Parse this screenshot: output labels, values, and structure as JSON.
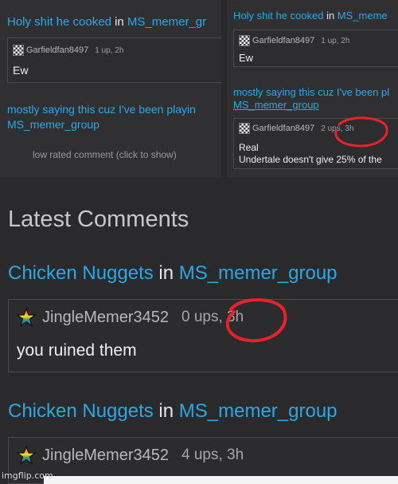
{
  "top_left": {
    "thread1": {
      "title": "Holy shit he cooked",
      "in": " in ",
      "group": "MS_memer_gr"
    },
    "comment1": {
      "user": "Garfieldfan8497",
      "meta": "1 up, 2h",
      "body": "Ew"
    },
    "thread2": {
      "title": "mostly saying this cuz I've been playin",
      "group": "MS_memer_group"
    },
    "low_rated": "low rated comment (click to show)"
  },
  "top_right": {
    "thread1": {
      "title": "Holy shit he cooked",
      "in": " in ",
      "group": "MS_meme"
    },
    "comment1": {
      "user": "Garfieldfan8497",
      "meta": "1 up, 2h",
      "body": "Ew"
    },
    "thread2": {
      "title": "mostly saying this cuz I've been pl",
      "group": "MS_memer_group"
    },
    "comment2": {
      "user": "Garfieldfan8497",
      "meta": "2 ups, 3h",
      "line1": "Real",
      "line2": "Undertale doesn't give 25% of the"
    }
  },
  "main": {
    "heading": "Latest Comments",
    "thread1": {
      "title": "Chicken Nuggets",
      "in": " in ",
      "group": "MS_memer_group"
    },
    "comment1": {
      "user": "JingleMemer3452",
      "meta": "0 ups, 3h",
      "body": "you ruined them"
    },
    "thread2": {
      "title": "Chicken Nuggets",
      "in": " in ",
      "group": "MS_memer_group"
    },
    "comment2": {
      "user": "JingleMemer3452",
      "meta": "4 ups, 3h"
    }
  },
  "watermark": "imgflip.com",
  "colors": {
    "background": "#2a2a2c",
    "link": "#29a8e6",
    "annotation": "#e8222a"
  },
  "icons": {
    "avatar_small": "checkerboard-avatar-icon",
    "avatar_large": "rainbow-star-icon"
  }
}
